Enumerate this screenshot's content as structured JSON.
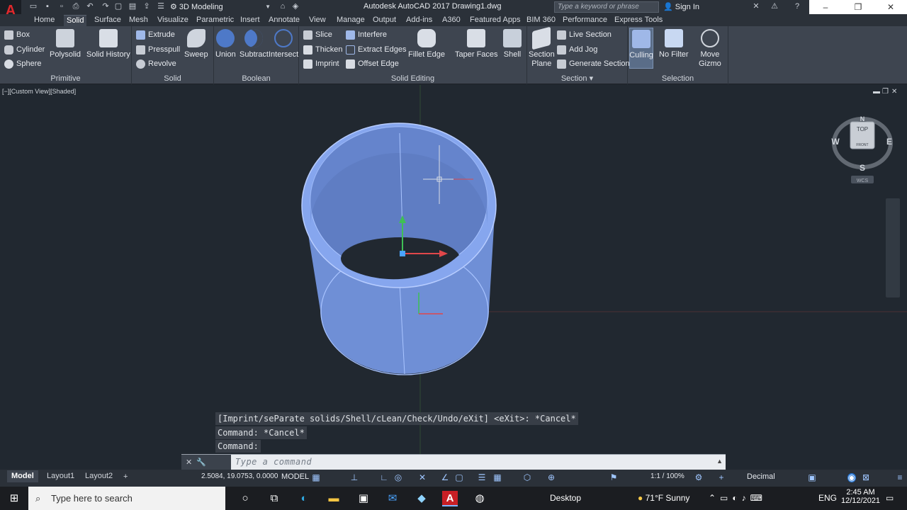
{
  "titlebar": {
    "workspace": "3D Modeling",
    "title": "Autodesk AutoCAD 2017   Drawing1.dwg",
    "search_placeholder": "Type a keyword or phrase",
    "signin": "Sign In",
    "app_letter": "A"
  },
  "tabs": [
    "Home",
    "Solid",
    "Surface",
    "Mesh",
    "Visualize",
    "Parametric",
    "Insert",
    "Annotate",
    "View",
    "Manage",
    "Output",
    "Add-ins",
    "A360",
    "Featured Apps",
    "BIM 360",
    "Performance",
    "Express Tools"
  ],
  "active_tab": "Solid",
  "ribbon": {
    "primitive": {
      "label": "Primitive",
      "box": "Box",
      "cylinder": "Cylinder",
      "sphere": "Sphere",
      "polysolid": "Polysolid",
      "solid_history": "Solid History"
    },
    "solid": {
      "label": "Solid",
      "extrude": "Extrude",
      "presspull": "Presspull",
      "revolve": "Revolve",
      "sweep": "Sweep"
    },
    "boolean": {
      "label": "Boolean",
      "union": "Union",
      "subtract": "Subtract",
      "intersect": "Intersect"
    },
    "solid_editing": {
      "label": "Solid Editing",
      "slice": "Slice",
      "thicken": "Thicken",
      "imprint": "Imprint",
      "interfere": "Interfere",
      "extract_edges": "Extract Edges",
      "offset_edge": "Offset Edge",
      "fillet_edge": "Fillet Edge",
      "taper_faces": "Taper Faces",
      "shell": "Shell"
    },
    "section": {
      "label": "Section",
      "section_plane": "Section\nPlane",
      "live_section": "Live Section",
      "add_jog": "Add Jog",
      "generate_section": "Generate Section"
    },
    "selection": {
      "label": "Selection",
      "culling": "Culling",
      "no_filter": "No Filter",
      "move_gizmo": "Move\nGizmo"
    }
  },
  "viewport": {
    "label": "[−][Custom View][Shaded]",
    "viewcube": {
      "top": "TOP",
      "front": "FRONT",
      "n": "N",
      "s": "S",
      "e": "E",
      "w": "W",
      "wcs": "WCS"
    }
  },
  "command_history": [
    "[Imprint/seParate solids/Shell/cLean/Check/Undo/eXit] <eXit>: *Cancel*",
    "Command: *Cancel*",
    "Command:"
  ],
  "command_input_placeholder": "Type a command",
  "statusbar": {
    "layout_tabs": [
      "Model",
      "Layout1",
      "Layout2"
    ],
    "coords": "2.5084, 19.0753, 0.0000",
    "space": "MODEL",
    "scale": "1:1 / 100%",
    "units": "Decimal"
  },
  "taskbar": {
    "search_placeholder": "Type here to search",
    "desktop": "Desktop",
    "weather": "71°F  Sunny",
    "lang": "ENG",
    "time": "2:45 AM",
    "date": "12/12/2021"
  },
  "colors": {
    "cylinder_fill": "#6f8fd6",
    "cylinder_edge": "#a9c4ff",
    "background": "#212830",
    "ribbon": "#3e4550"
  }
}
